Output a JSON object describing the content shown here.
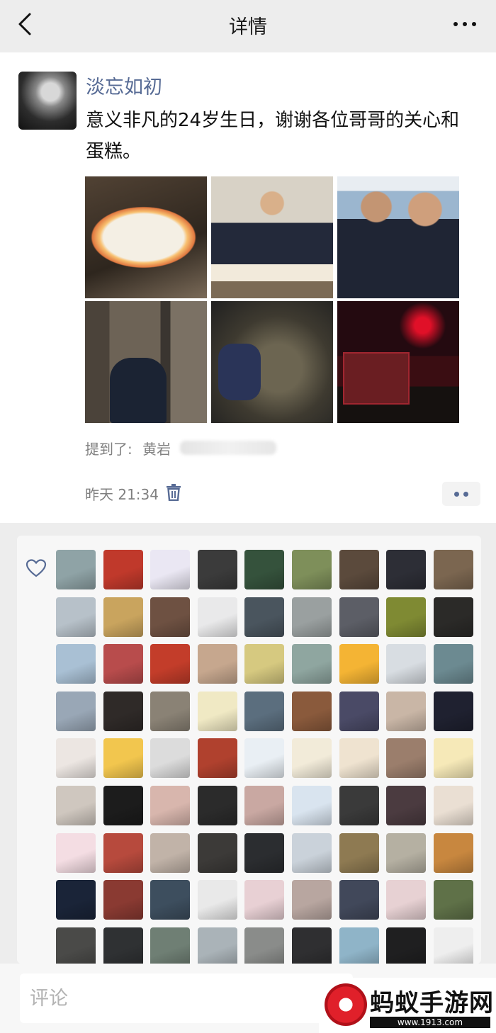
{
  "navbar": {
    "title": "详情"
  },
  "post": {
    "author": "淡忘如初",
    "text": "意义非凡的24岁生日，谢谢各位哥哥的关心和蛋糕。",
    "photos": [
      "birthday-cake-photo",
      "officer-with-cake-photo",
      "two-officers-selfie-photo",
      "officers-at-doorway-photo",
      "boots-on-ground-photo",
      "fire-truck-night-photo"
    ],
    "mention_label": "提到了:",
    "mention_name": "黄岩",
    "timestamp": "昨天 21:34"
  },
  "likes": {
    "avatars": [
      "#8fa3a6",
      "#c0392b",
      "#eae7f3",
      "#3b3b3b",
      "#35523c",
      "#7e8f5a",
      "#5b4a3c",
      "#2d2e36",
      "#7b6650",
      "#b7c1c9",
      "#c9a45e",
      "#6e5142",
      "#e9e9ea",
      "#4a555e",
      "#9aa0a0",
      "#5c5e66",
      "#7f8a33",
      "#2b2a28",
      "#a9c0d4",
      "#b84c4c",
      "#c33d2a",
      "#c6a78e",
      "#d6c980",
      "#8fa6a0",
      "#f4b434",
      "#d8dde2",
      "#6c8a91",
      "#99a7b6",
      "#2f2a28",
      "#8a8275",
      "#f0e9c4",
      "#5b6e7e",
      "#8a5a3c",
      "#4a4a66",
      "#c9b6a6",
      "#1f2130",
      "#ece6e2",
      "#f2c64e",
      "#dcdcdc",
      "#b0412e",
      "#e9eff4",
      "#f2ebd9",
      "#efe3d0",
      "#9b7e6c",
      "#f6e9b8",
      "#cfc7bf",
      "#1c1c1c",
      "#d8b6ad",
      "#2b2b2b",
      "#c9a8a2",
      "#d9e4ef",
      "#3a3a3a",
      "#4b3b40",
      "#eadfd3",
      "#f4dde3",
      "#b74a3d",
      "#c1b3a8",
      "#3c3a38",
      "#2b2d30",
      "#cad2da",
      "#8e7a52",
      "#b5b0a2",
      "#c8873f",
      "#1a2438",
      "#8a3a32",
      "#3d4e5e",
      "#e9e9e9",
      "#e8d0d4",
      "#b8a6a0",
      "#41485a",
      "#e7d1d3",
      "#5f7148",
      "#4a4a48",
      "#2f3133",
      "#6f7f74",
      "#aab3b8",
      "#8a8c8a",
      "#2f2f31",
      "#8fb4c8",
      "#1f1f20",
      "#eeeeee"
    ]
  },
  "comment": {
    "placeholder": "评论"
  },
  "watermark": {
    "name": "蚂蚁手游网",
    "url": "www.1913.com"
  }
}
